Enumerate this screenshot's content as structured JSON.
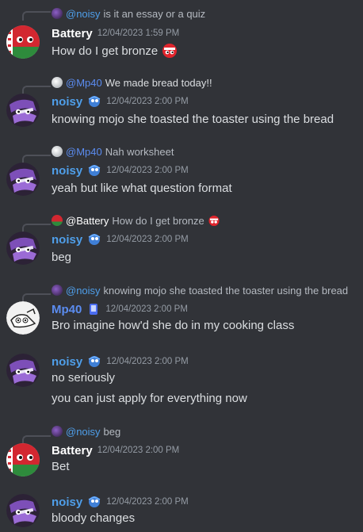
{
  "messages": [
    {
      "reply": {
        "name": "@noisy",
        "text": "is it an essay or a quiz"
      },
      "author": "Battery",
      "timestamp": "12/04/2023 1:59 PM",
      "lines": [
        "How do I get bronze"
      ]
    },
    {
      "reply": {
        "name": "@Mp40",
        "text": "We made bread today!!"
      },
      "author": "noisy",
      "timestamp": "12/04/2023 2:00 PM",
      "lines": [
        "knowing mojo she toasted the toaster using the bread"
      ]
    },
    {
      "reply": {
        "name": "@Mp40",
        "text": "Nah worksheet"
      },
      "author": "noisy",
      "timestamp": "12/04/2023 2:00 PM",
      "lines": [
        "yeah but like what question format"
      ]
    },
    {
      "reply": {
        "name": "@Battery",
        "text": "How do I get bronze"
      },
      "author": "noisy",
      "timestamp": "12/04/2023 2:00 PM",
      "lines": [
        "beg"
      ]
    },
    {
      "reply": {
        "name": "@noisy",
        "text": "knowing mojo she toasted the toaster using the bread"
      },
      "author": "Mp40",
      "timestamp": "12/04/2023 2:00 PM",
      "lines": [
        "Bro imagine how'd she do in my cooking class"
      ]
    },
    {
      "author": "noisy",
      "timestamp": "12/04/2023 2:00 PM",
      "lines": [
        "no seriously",
        "you can just apply for everything now"
      ]
    },
    {
      "reply": {
        "name": "@noisy",
        "text": "beg"
      },
      "author": "Battery",
      "timestamp": "12/04/2023 2:00 PM",
      "lines": [
        "Bet"
      ]
    },
    {
      "author": "noisy",
      "timestamp": "12/04/2023 2:00 PM",
      "lines": [
        "bloody changes"
      ]
    }
  ],
  "colors": {
    "background": "#313338",
    "text": "#dbdee1",
    "muted": "#949ba4",
    "battery": "#ffffff",
    "noisy": "#4f9fea",
    "mp40": "#5b8cf0"
  },
  "icons": {
    "battery_avatar": "belarus-countryball-avatar",
    "noisy_avatar": "purple-countryball-avatar",
    "mp40_avatar": "white-sketch-avatar",
    "noisy_badge": "blue-countryball-badge-icon",
    "mp40_badge": "phone-badge-icon",
    "bronze_emoji": "red-countryball-emoji"
  }
}
